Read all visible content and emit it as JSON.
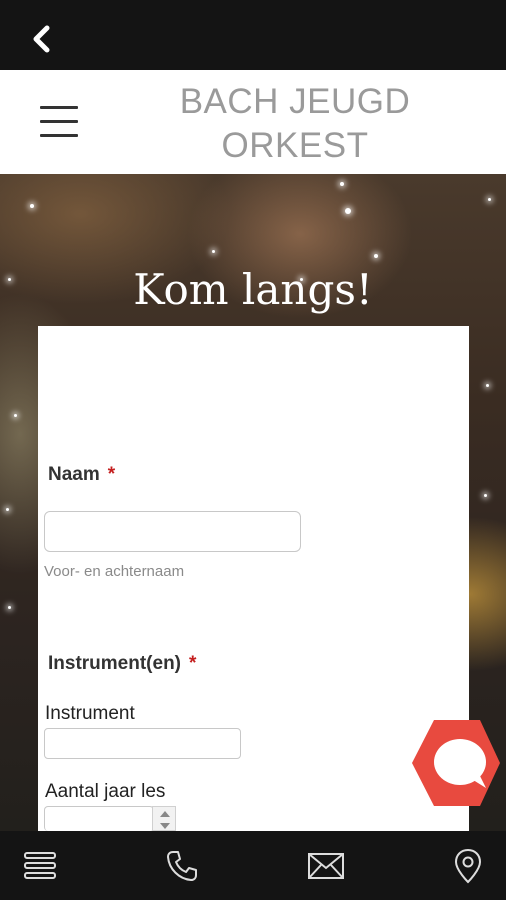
{
  "header": {
    "title_line1": "BACH JEUGD",
    "title_line2": "ORKEST"
  },
  "hero": {
    "title": "Kom langs!"
  },
  "form": {
    "name_label": "Naam",
    "required_mark": "*",
    "name_hint": "Voor- en achternaam",
    "instruments_label": "Instrument(en)",
    "instrument_label": "Instrument",
    "years_label": "Aantal jaar les",
    "name_value": "",
    "instrument_value": "",
    "years_value": ""
  },
  "colors": {
    "top_bar": "#141414",
    "title_gray": "#9a9a9a",
    "required_red": "#c41e1e",
    "chat_button": "#e84a3f"
  },
  "icons": {
    "back": "chevron-left-icon",
    "menu": "hamburger-icon",
    "chat": "chat-bubble-icon",
    "nav": [
      "stack-icon",
      "phone-icon",
      "mail-icon",
      "location-pin-icon"
    ]
  }
}
